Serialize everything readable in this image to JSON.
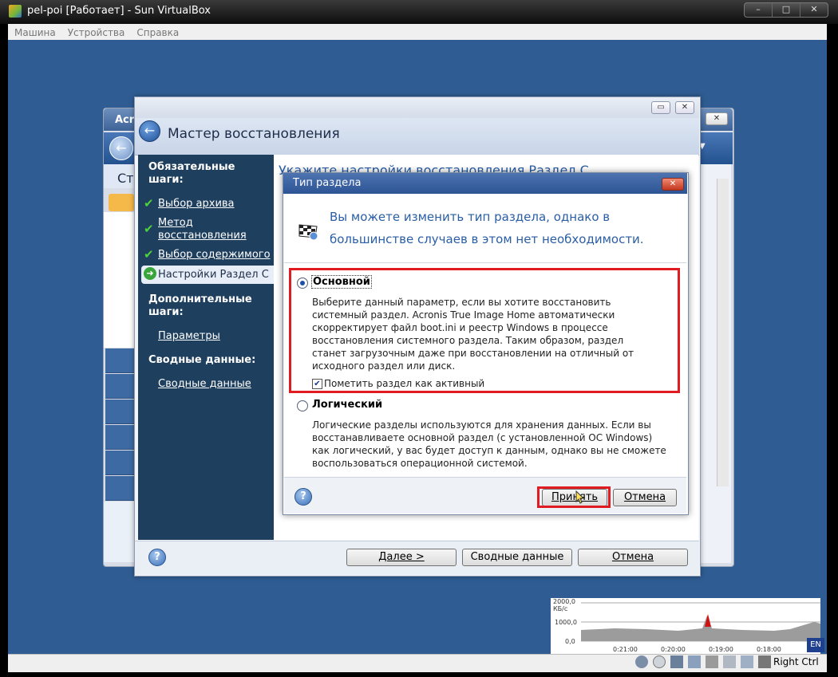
{
  "host": {
    "title": "pel-poi [Работает] - Sun VirtualBox",
    "menu": [
      "Машина",
      "Устройства",
      "Справка"
    ],
    "window_buttons": [
      "–",
      "□",
      "✕"
    ],
    "status_right": "Right Ctrl",
    "lang": "EN"
  },
  "bg_app": {
    "title": "Acr",
    "nav_label": "Ста"
  },
  "wizard": {
    "title": "Мастер восстановления",
    "main_title": "Укажите настройки восстановления Раздел С",
    "sidebar": {
      "required_heading": "Обязательные шаги:",
      "steps_done": [
        "Выбор архива",
        "Метод восстановления",
        "Выбор содержимого"
      ],
      "current_step": "Настройки Раздел С",
      "optional_heading": "Дополнительные шаги:",
      "optional_steps": [
        "Параметры"
      ],
      "summary_heading": "Сводные данные:",
      "summary_steps": [
        "Сводные данные"
      ]
    },
    "footer": {
      "next_label": "Далее >",
      "summary_label": "Сводные данные",
      "cancel_label": "Отмена"
    }
  },
  "dialog": {
    "title": "Тип раздела",
    "intro": "Вы можете изменить тип раздела, однако в большинстве случаев в этом нет необходимости.",
    "option_primary": {
      "label": "Основной",
      "selected": true,
      "description": "Выберите данный параметр, если вы хотите восстановить системный раздел. Acronis True Image Home автоматически скорректирует файл boot.ini и реестр Windows в процессе восстановления системного раздела. Таким образом, раздел станет загрузочным даже при восстановлении на отличный от исходного раздел или диск.",
      "checkbox_label": "Пометить раздел как активный",
      "checkbox_checked": true
    },
    "option_logical": {
      "label": "Логический",
      "selected": false,
      "description": "Логические разделы используются для хранения данных. Если вы восстанавливаете основной раздел (с установленной ОС Windows) как логический, у вас будет доступ к данным, однако вы не сможете воспользоваться операционной системой."
    },
    "accept_label": "Принять",
    "cancel_label": "Отмена"
  },
  "net_graph": {
    "y_labels": [
      "2000,0 КБ/с",
      "1000,0",
      "0,0"
    ],
    "x_labels": [
      "0:21:00",
      "0:20:00",
      "0:19:00",
      "0:18:00"
    ]
  },
  "colors": {
    "guest_desktop": "#2f5d93",
    "wizard_sidebar": "#1f3f5f",
    "highlight": "#e11b22",
    "accent_text": "#2a5ea5"
  }
}
